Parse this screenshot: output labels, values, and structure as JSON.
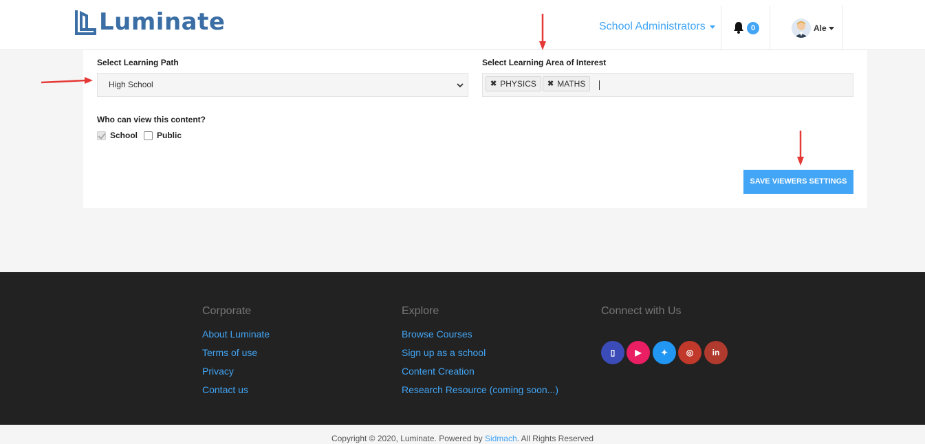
{
  "brand": {
    "name": "Luminate",
    "color": "#3a6ea5"
  },
  "nav": {
    "role_label": "School Administrators",
    "notifications_count": "0",
    "user_name": "Ale"
  },
  "form": {
    "learning_path_label": "Select Learning Path",
    "learning_path_value": "High School",
    "learning_area_label": "Select Learning Area of Interest",
    "learning_area_tags": [
      "PHYSICS",
      "MATHS"
    ],
    "viewers_label": "Who can view this content?",
    "viewer_options": [
      {
        "label": "School",
        "checked": true
      },
      {
        "label": "Public",
        "checked": false
      }
    ],
    "save_button": "SAVE VIEWERS SETTINGS"
  },
  "footer": {
    "columns": [
      {
        "heading": "Corporate",
        "links": [
          "About Luminate",
          "Terms of use",
          "Privacy",
          "Contact us"
        ]
      },
      {
        "heading": "Explore",
        "links": [
          "Browse Courses",
          "Sign up as a school",
          "Content Creation",
          "Research Resource (coming soon...)"
        ]
      },
      {
        "heading": "Connect with Us",
        "links": []
      }
    ],
    "social": [
      {
        "icon": "facebook-icon",
        "glyph": "▯",
        "color": "#3b4cb8"
      },
      {
        "icon": "youtube-icon",
        "glyph": "▶",
        "color": "#e91e63"
      },
      {
        "icon": "twitter-icon",
        "glyph": "✦",
        "color": "#2196f3"
      },
      {
        "icon": "instagram-icon",
        "glyph": "◎",
        "color": "#c0392b"
      },
      {
        "icon": "linkedin-icon",
        "glyph": "in",
        "color": "#b03a2e"
      }
    ],
    "copyright_prefix": "Copyright © 2020, Luminate. Powered by ",
    "copyright_link": "Sidmach",
    "copyright_suffix": ". All Rights Reserved"
  },
  "colors": {
    "accent": "#42a5f5",
    "footer_bg": "#222222",
    "annotation_arrow": "#e53935"
  }
}
